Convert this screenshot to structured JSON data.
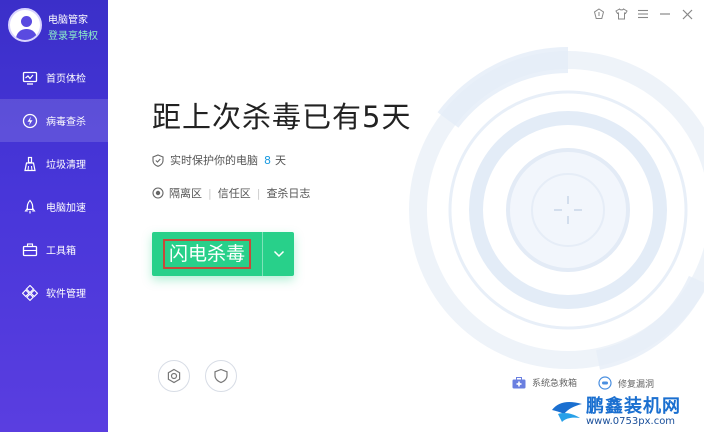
{
  "app": {
    "name": "电脑管家",
    "login_text": "登录享特权"
  },
  "sidebar": {
    "items": [
      {
        "label": "首页体检",
        "icon": "monitor-icon",
        "active": false
      },
      {
        "label": "病毒查杀",
        "icon": "lightning-shield-icon",
        "active": true
      },
      {
        "label": "垃圾清理",
        "icon": "broom-icon",
        "active": false
      },
      {
        "label": "电脑加速",
        "icon": "rocket-icon",
        "active": false
      },
      {
        "label": "工具箱",
        "icon": "toolbox-icon",
        "active": false
      },
      {
        "label": "软件管理",
        "icon": "apps-icon",
        "active": false
      }
    ]
  },
  "window_controls": [
    "skin-icon",
    "shirt-icon",
    "menu-icon",
    "minimize-icon",
    "close-icon"
  ],
  "main": {
    "headline": "距上次杀毒已有5天",
    "protect_text": "实时保护你的电脑",
    "protect_days": "8",
    "protect_unit": "天",
    "links": [
      "隔离区",
      "信任区",
      "查杀日志"
    ],
    "scan_button": "闪电杀毒",
    "bottom_links": [
      {
        "label": "系统急救箱",
        "icon": "first-aid-kit-icon"
      },
      {
        "label": "修复漏洞",
        "icon": "patch-icon"
      }
    ]
  },
  "watermark": {
    "title": "鹏鑫装机网",
    "url": "www.0753px.com"
  },
  "colors": {
    "sidebar": "#4432d4",
    "accent_green": "#28d08a",
    "days_blue": "#1c9be0",
    "login_green": "#8ef0c8"
  }
}
